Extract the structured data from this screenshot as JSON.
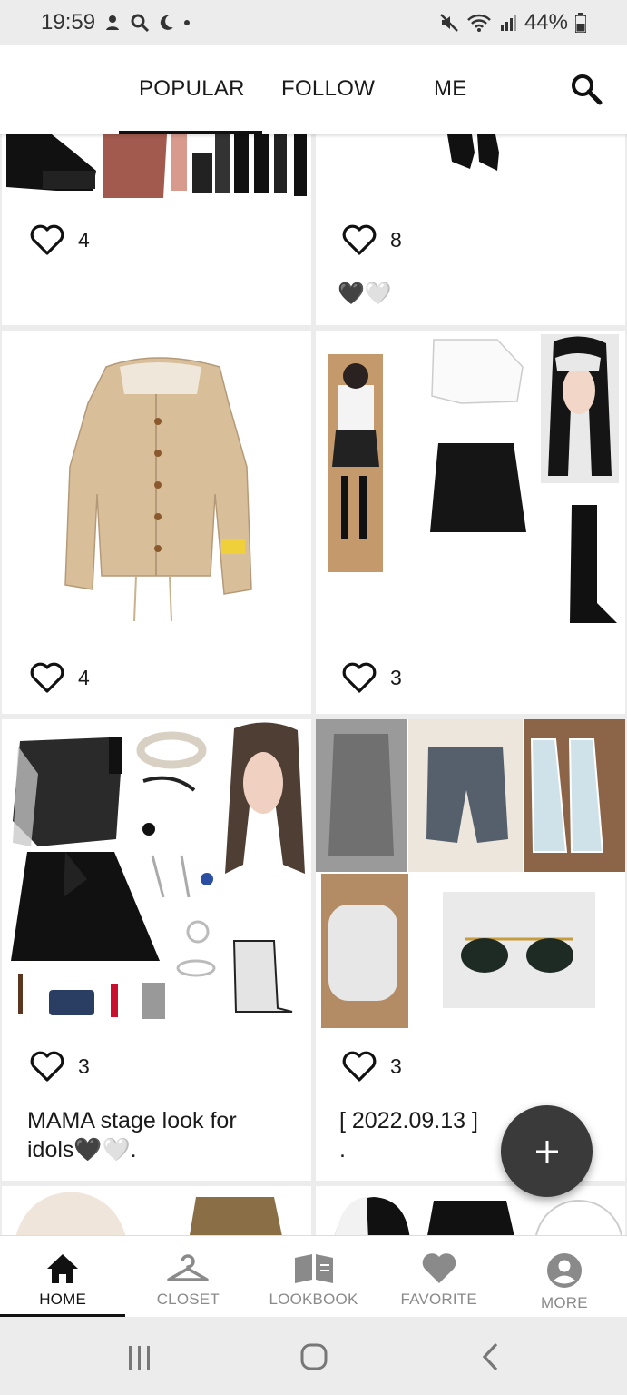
{
  "status_bar": {
    "time": "19:59",
    "battery": "44%"
  },
  "top_tabs": [
    {
      "label": "POPULAR",
      "active": true
    },
    {
      "label": "FOLLOW",
      "active": false
    },
    {
      "label": "ME",
      "active": false
    }
  ],
  "posts": [
    {
      "likes": "4",
      "caption": ""
    },
    {
      "likes": "8",
      "caption": "🖤🤍"
    },
    {
      "likes": "4",
      "caption": ""
    },
    {
      "likes": "3",
      "caption": ""
    },
    {
      "likes": "3",
      "caption_line1": "MAMA stage look for",
      "caption_line2": "idols🖤🤍."
    },
    {
      "likes": "3",
      "caption_line1": "[ 2022.09.13 ]",
      "caption_line2": "."
    }
  ],
  "bottom_nav": [
    {
      "label": "HOME",
      "icon": "home-icon",
      "active": true
    },
    {
      "label": "CLOSET",
      "icon": "hanger-icon",
      "active": false
    },
    {
      "label": "LOOKBOOK",
      "icon": "book-icon",
      "active": false
    },
    {
      "label": "FAVORITE",
      "icon": "heart-icon",
      "active": false
    },
    {
      "label": "MORE",
      "icon": "account-icon",
      "active": false
    }
  ],
  "colors": {
    "accent": "#111111",
    "fab": "#3a3a3a",
    "inactive": "#8a8a8a"
  }
}
